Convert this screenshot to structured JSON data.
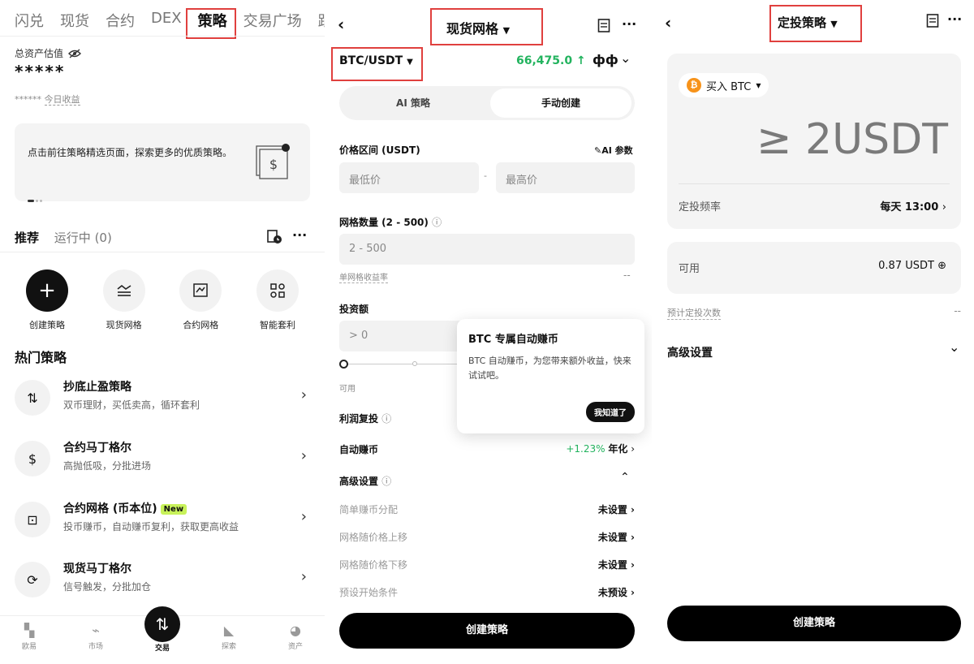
{
  "panel1": {
    "nav": [
      "闪兑",
      "现货",
      "合约",
      "DEX",
      "策略",
      "交易广场",
      "跟"
    ],
    "assets_label": "总资产估值",
    "assets_value": "*****",
    "today_mask": "******",
    "today_label": "今日收益",
    "banner_text": "点击前往策略精选页面，探索更多的优质策略。",
    "section_tabs": {
      "recommend": "推荐",
      "running": "运行中 (0)"
    },
    "quick": [
      {
        "label": "创建策略",
        "icon": "plus-icon"
      },
      {
        "label": "现货网格",
        "icon": "grid-icon"
      },
      {
        "label": "合约网格",
        "icon": "futures-grid-icon"
      },
      {
        "label": "智能套利",
        "icon": "arbitrage-icon"
      }
    ],
    "hot_title": "热门策略",
    "hot": [
      {
        "title": "抄底止盈策略",
        "desc": "双币理财，买低卖高，循环套利",
        "icon": "buy-dip-icon"
      },
      {
        "title": "合约马丁格尔",
        "desc": "高抛低吸，分批进场",
        "icon": "martingale-icon"
      },
      {
        "title": "合约网格 (币本位)",
        "desc": "投币赚币，自动赚币复利，获取更高收益",
        "icon": "coin-grid-icon",
        "badge": "New"
      },
      {
        "title": "现货马丁格尔",
        "desc": "信号触发，分批加仓",
        "icon": "spot-martingale-icon"
      }
    ],
    "tabs": [
      {
        "label": "欧易",
        "icon": "okx-logo-icon"
      },
      {
        "label": "市场",
        "icon": "market-icon"
      },
      {
        "label": "交易",
        "icon": "trade-icon"
      },
      {
        "label": "探索",
        "icon": "explore-icon"
      },
      {
        "label": "资产",
        "icon": "assets-icon"
      }
    ]
  },
  "panel2": {
    "title": "现货网格",
    "pair": "BTC/USDT",
    "price": "66,475.0 ↑",
    "tabs": {
      "ai": "AI 策略",
      "manual": "手动创建"
    },
    "price_range_label": "价格区间 (USDT)",
    "ai_params": "AI 参数",
    "min_ph": "最低价",
    "max_ph": "最高价",
    "grid_count_label": "网格数量 (2 - 500)",
    "grid_count_ph": "2 - 500",
    "per_grid_label": "单网格收益率",
    "per_grid_value": "--",
    "invest_label": "投资额",
    "invest_ph": "> 0",
    "available_label": "可用",
    "reinvest_label": "利润复投",
    "auto_earn_label": "自动赚币",
    "auto_earn_rate": "+1.23%",
    "auto_earn_suffix": "年化",
    "advanced_label": "高级设置",
    "settings": [
      {
        "label": "简单赚币分配",
        "value": "未设置"
      },
      {
        "label": "网格随价格上移",
        "value": "未设置"
      },
      {
        "label": "网格随价格下移",
        "value": "未设置"
      },
      {
        "label": "预设开始条件",
        "value": "未预设"
      }
    ],
    "create_btn": "创建策略",
    "tooltip": {
      "title": "BTC 专属自动赚币",
      "body": "BTC 自动赚币，为您带来额外收益，快来试试吧。",
      "btn": "我知道了"
    }
  },
  "panel3": {
    "title": "定投策略",
    "buy_label": "买入 BTC",
    "amount": "≥ 2USDT",
    "freq_label": "定投频率",
    "freq_value": "每天 13:00",
    "available_label": "可用",
    "available_value": "0.87 USDT",
    "est_label": "预计定投次数",
    "est_value": "--",
    "advanced_label": "高级设置",
    "create_btn": "创建策略"
  },
  "colors": {
    "accent_green": "#22b35e",
    "highlight_red": "#e0403e",
    "new_badge": "#c8f25a",
    "btc_orange": "#f7931a"
  }
}
